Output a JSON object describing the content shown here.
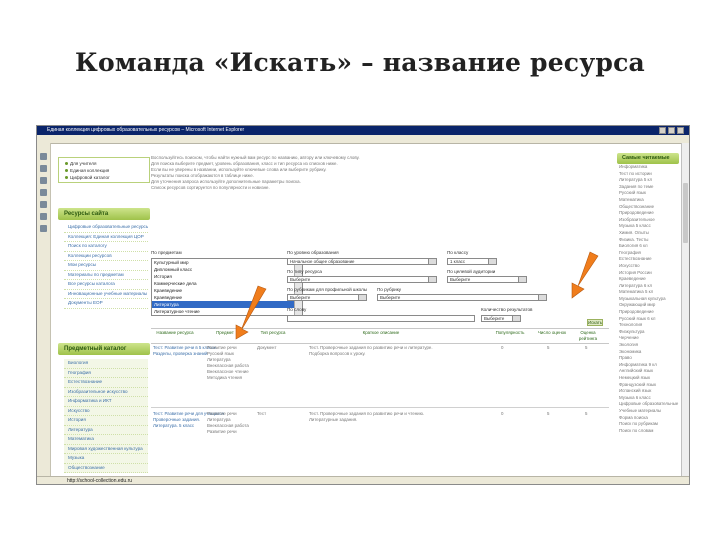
{
  "slide": {
    "title": "Команда «Искать» – название ресурса"
  },
  "window": {
    "title": "Единая коллекция цифровых образовательных ресурсов – Microsoft Internet Explorer",
    "status_url": "http://school-collection.edu.ru"
  },
  "sidebar": {
    "options": [
      "Для учителя",
      "Единая коллекция",
      "Цифровой каталог"
    ],
    "resources_header": "Ресурсы сайта",
    "resources_items": [
      "Цифровые образовательные ресурсы",
      "Коллекция: Единая коллекция ЦОР",
      "Поиск по каталогу",
      "Коллекции ресурсов",
      "Мои ресурсы",
      "Материалы по предметам",
      "Все ресурсы каталога",
      "Инновационные учебные материалы",
      "Документы ЕОР"
    ],
    "catalog_header": "Предметный каталог",
    "catalog_items": [
      "Биология",
      "География",
      "Естествознание",
      "Изобразительное искусство",
      "Информатика и ИКТ",
      "Искусство",
      "История",
      "Литература",
      "Математика",
      "Мировая художественная культура",
      "Музыка",
      "Обществознание"
    ]
  },
  "main": {
    "paragraph_lines": [
      "Воспользуйтесь поиском, чтобы найти нужный вам ресурс по названию, автору или ключевому слову.",
      "Для поиска выберите предмет, уровень образования, класс и тип ресурса из списков ниже.",
      "Если вы не уверены в названии, используйте ключевые слова или выберите рубрику.",
      "Результаты поиска отображаются в таблице ниже.",
      "Для уточнения запроса используйте дополнительные параметры поиска.",
      "Список ресурсов сортируется по популярности и новизне."
    ],
    "filters": {
      "subject_label": "По предметам",
      "subject_list": [
        "Культурный мир",
        "Дипломный класс",
        "История",
        "Коммерческие дела",
        "Краеведение",
        "Краеведение",
        "Литература",
        "Литературное чтение"
      ],
      "level_label": "По уровню образования",
      "level_value": "Начальное общее образование",
      "class_label": "По классу",
      "class_value": "1 класс",
      "type_label": "По типу ресурса",
      "type_value": "Выберите",
      "audience_label": "По целевой аудитории",
      "audience_value": "Выберите",
      "profile_label": "По рубрикам для профильной школы",
      "profile_value": "Выберите",
      "rubric_label": "По рубрику",
      "rubric_value": "Выберите",
      "text_label": "По слову",
      "count_label": "Количество результатов",
      "count_value": "Выберите",
      "search_button": "Искать"
    },
    "table": {
      "headers": [
        "Название ресурса",
        "Предмет",
        "Тип ресурса",
        "Краткое описание",
        "Популярность",
        "Число оценок",
        "Оценка рейтинга"
      ],
      "rows": [
        {
          "title_lines": [
            "Тест: Развитие речи в 5 классе.",
            "Разделы, проверка знаний"
          ],
          "subject_lines": [
            "Развитие речи",
            "Русский язык",
            "Литература",
            "Внеклассная работа",
            "Внеклассное чтение",
            "Методика чтения"
          ],
          "type": "Документ",
          "desc_lines": [
            "Тест. Проверочные задания по развитию речи и литературе.",
            "Подборка вопросов к уроку."
          ],
          "popularity": "0",
          "votes": "5",
          "rating": "5"
        },
        {
          "title_lines": [
            "Тест: Развитие речи для учащихся",
            "Проверочные задания.",
            "Литература. 5 класс"
          ],
          "subject_lines": [
            "Развитие речи",
            "Литература",
            "Внеклассная работа",
            "Развитие речи"
          ],
          "type": "Тест",
          "desc_lines": [
            "Тест. Проверочные задания по развитию речи и чтению.",
            "Литературные задания."
          ],
          "popularity": "0",
          "votes": "5",
          "rating": "5"
        }
      ]
    }
  },
  "right": {
    "header": "Самые читаемые",
    "lines": [
      "Информатика",
      "Тест по истории",
      "Литература 5 кл",
      "Задания по теме",
      "Русский язык",
      "Математика",
      "Обществознание",
      "Природоведение",
      "Изобразительное",
      "Музыка 5 класс",
      "Химия. Опыты",
      "Физика. Тесты",
      "Биология 6 кл",
      "География",
      "Естествознание",
      "Искусство",
      "История России",
      "Краеведение",
      "Литература 6 кл",
      "Математика 5 кл",
      "Музыкальная культура",
      "Окружающий мир",
      "Природоведение",
      "Русский язык 6 кл",
      "Технология",
      "Физкультура",
      "Черчение",
      "Экология",
      "Экономика",
      "Право",
      "Информатика 9 кл",
      "Английский язык",
      "Немецкий язык",
      "Французский язык",
      "Испанский язык",
      "Музыка 6 класс",
      "Цифровые образовательные",
      "Учебные материалы",
      "Форма поиска",
      "Поиск по рубрикам",
      "Поиск по словам"
    ]
  },
  "arrow_color": "#f07d1c"
}
